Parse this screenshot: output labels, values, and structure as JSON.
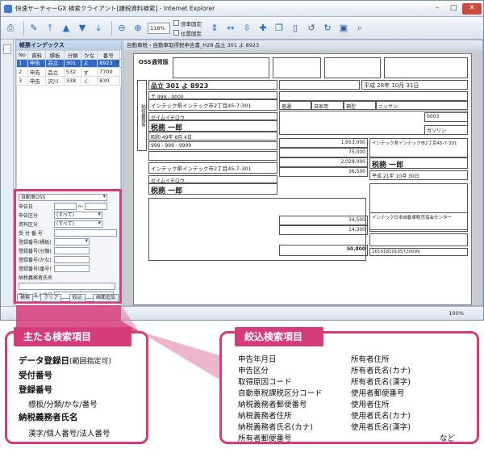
{
  "window": {
    "title": "快速サーチャーGX 検索クライアント[課税資料検索] - Internet Explorer",
    "controls": [
      "–",
      "□",
      "✕"
    ]
  },
  "toolbar": {
    "zoom": "118%",
    "checkboxes": [
      "倍率固定",
      "位置固定"
    ]
  },
  "index_panel": {
    "title": "帳票インデックス",
    "columns": [
      "No",
      "資料",
      "標板",
      "分類",
      "かな",
      "番号"
    ],
    "rows": [
      {
        "no": "1",
        "doc": "申告",
        "plate": "品立",
        "cls": "301",
        "kana": "よ",
        "num": "8923"
      },
      {
        "no": "2",
        "doc": "申告",
        "plate": "品立",
        "cls": "532",
        "kana": "す",
        "num": "7700"
      },
      {
        "no": "3",
        "doc": "申告",
        "plate": "沢川",
        "cls": "338",
        "kana": "く",
        "num": "830"
      }
    ]
  },
  "search_panel": {
    "doc_type": "自動車OSS",
    "fields": [
      {
        "label": "申告日",
        "value": "",
        "suffix": "～"
      },
      {
        "label": "申告区分",
        "value": "(すべて)"
      },
      {
        "label": "資料区分",
        "value": "(すべて)"
      },
      {
        "label": "受 付 番 号",
        "value": ""
      },
      {
        "label": "登録番号(標板)",
        "value": ""
      },
      {
        "label": "登録番号(分類)",
        "value": ""
      },
      {
        "label": "登録番号(かな)",
        "value": ""
      },
      {
        "label": "登録番号(番号)",
        "value": ""
      },
      {
        "label": "納税義務者氏名",
        "value": ""
      },
      {
        "label": "個人・法人番号",
        "value": ""
      }
    ],
    "buttons": [
      "検索",
      "クリア",
      "絞込",
      "画面追加"
    ]
  },
  "document": {
    "tab_label": "自動車税・自動車取得税申告書_H28 品立 301 よ 8923",
    "form_title": "OSS通常版",
    "plate": "品立 301 よ 8923",
    "reg_no": "品立 301 よ 8923",
    "date_issued": "平成 28年 10月 31日",
    "date_2": "平成 28年 10月 31日",
    "postal": "〒 999 - 0000",
    "address": "インテック県インテック市2丁目45-7-301",
    "kana_name": "ゼイムイチロウ",
    "name": "税務 一郎",
    "birth": "昭和 49年 8月 4日",
    "phone": "999 - 999 - 9999",
    "owner_address": "インテック県インテック市2丁目45-7-301",
    "owner_name": "税務 一郎",
    "amounts": [
      "1,953,000",
      "75,000",
      "2,028,000",
      "36,500",
      "34,500",
      "14,300",
      "50,800"
    ],
    "maker": "ニッサン",
    "fuel": "ガソリン",
    "model_code": "0003",
    "ymd_2": "平成 21年 10月 30日",
    "agent": "インテック日本自動車販売協会センター",
    "form_no": "16101810105720099",
    "kinds": [
      "普通",
      "自家用",
      "箱型"
    ]
  },
  "statusbar": {
    "zoom": "100%"
  },
  "callout_left": {
    "title": "主たる検索項目",
    "items": [
      {
        "text": "データ登録日",
        "sub": "(範囲指定可)",
        "indent": false
      },
      {
        "text": "受付番号",
        "sub": "",
        "indent": false
      },
      {
        "text": "登録番号",
        "sub": "",
        "indent": false
      },
      {
        "text": "標板/分類/かな/番号",
        "sub": "",
        "indent": true
      },
      {
        "text": "納税義務者氏名",
        "sub": "",
        "indent": false
      },
      {
        "text": "漢字/個人番号/法人番号",
        "sub": "",
        "indent": true
      }
    ]
  },
  "callout_right": {
    "title": "絞込検索項目",
    "col1": [
      "申告年月日",
      "申告区分",
      "取得原因コード",
      "自動車税課税区分コード",
      "納税義務者郵便番号",
      "納税義務者住所",
      "納税義務者氏名(カナ)",
      "所有者郵便番号"
    ],
    "col2": [
      "所有者住所",
      "所有者氏名(カナ)",
      "所有者氏名(漢字)",
      "使用者郵便番号",
      "使用者住所",
      "使用者氏名(カナ)",
      "使用者氏名(漢字)"
    ],
    "etc": "など"
  },
  "colors": {
    "accent": "#d63c7a",
    "selection": "#316ac5"
  }
}
